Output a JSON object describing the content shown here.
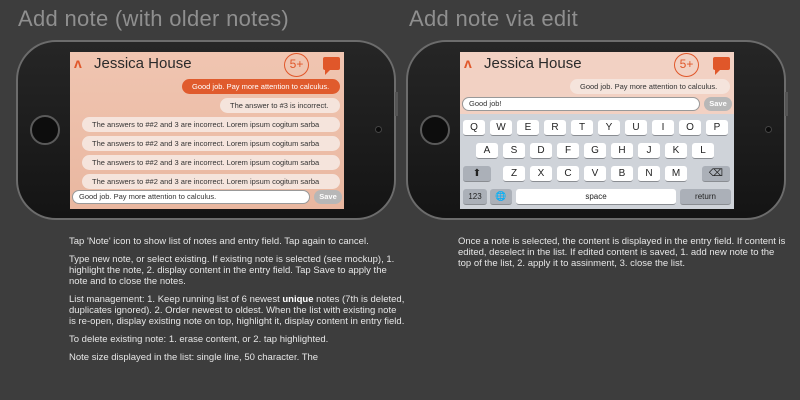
{
  "headings": {
    "left": "Add note (with older notes)",
    "right": "Add note via edit"
  },
  "app": {
    "title": "Jessica House",
    "badge": "5+"
  },
  "left_screen": {
    "notes": [
      "Good job. Pay more attention to calculus.",
      "The answer to #3 is incorrect.",
      "The answers to ##2 and 3 are incorrect.  Lorem ipsum cogitum sarba",
      "The answers to ##2 and 3 are incorrect.  Lorem ipsum cogitum sarba",
      "The answers to ##2 and 3 are incorrect.  Lorem ipsum cogitum sarba",
      "The answers to ##2 and 3 are incorrect.  Lorem ipsum cogitum sarba"
    ],
    "entry_value": "Good job. Pay more attention to calculus.",
    "save_label": "Save"
  },
  "right_screen": {
    "note": "Good job. Pay more attention to calculus.",
    "entry_value": "Good job!",
    "save_label": "Save",
    "keyboard": {
      "row1": [
        "Q",
        "W",
        "E",
        "R",
        "T",
        "Y",
        "U",
        "I",
        "O",
        "P"
      ],
      "row2": [
        "A",
        "S",
        "D",
        "F",
        "G",
        "H",
        "J",
        "K",
        "L"
      ],
      "row3": [
        "Z",
        "X",
        "C",
        "V",
        "B",
        "N",
        "M"
      ],
      "shift": "⬆",
      "backspace": "⌫",
      "numbers": "123",
      "globe": "🌐",
      "space": "space",
      "return": "return"
    }
  },
  "descriptions": {
    "left": [
      "Tap 'Note' icon to show list of notes and entry field. Tap again to cancel.",
      "Type new note, or select existing. If existing note is selected (see mockup), 1. highlight the note, 2. display content in the entry field. Tap Save to apply the note and to close the notes.",
      "List management: 1. Keep running list of 6 newest ",
      "unique",
      " notes (7th is deleted, duplicates ignored). 2. Order newest to oldest.  When the list with existing note is re-open, display existing note on top, highlight it, display content in entry field.",
      "To delete existing note: 1. erase content, or 2. tap highlighted.",
      "Note size displayed in the list: single line, 50 character. The"
    ],
    "right": "Once a note is selected, the content is displayed in the entry field. If content is edited, deselect in the list. If edited content is saved, 1. add new note to the top of the list, 2. apply it to assinment, 3. close the list."
  },
  "colors": {
    "accent": "#e05b2d",
    "background": "#3d3d3d"
  }
}
